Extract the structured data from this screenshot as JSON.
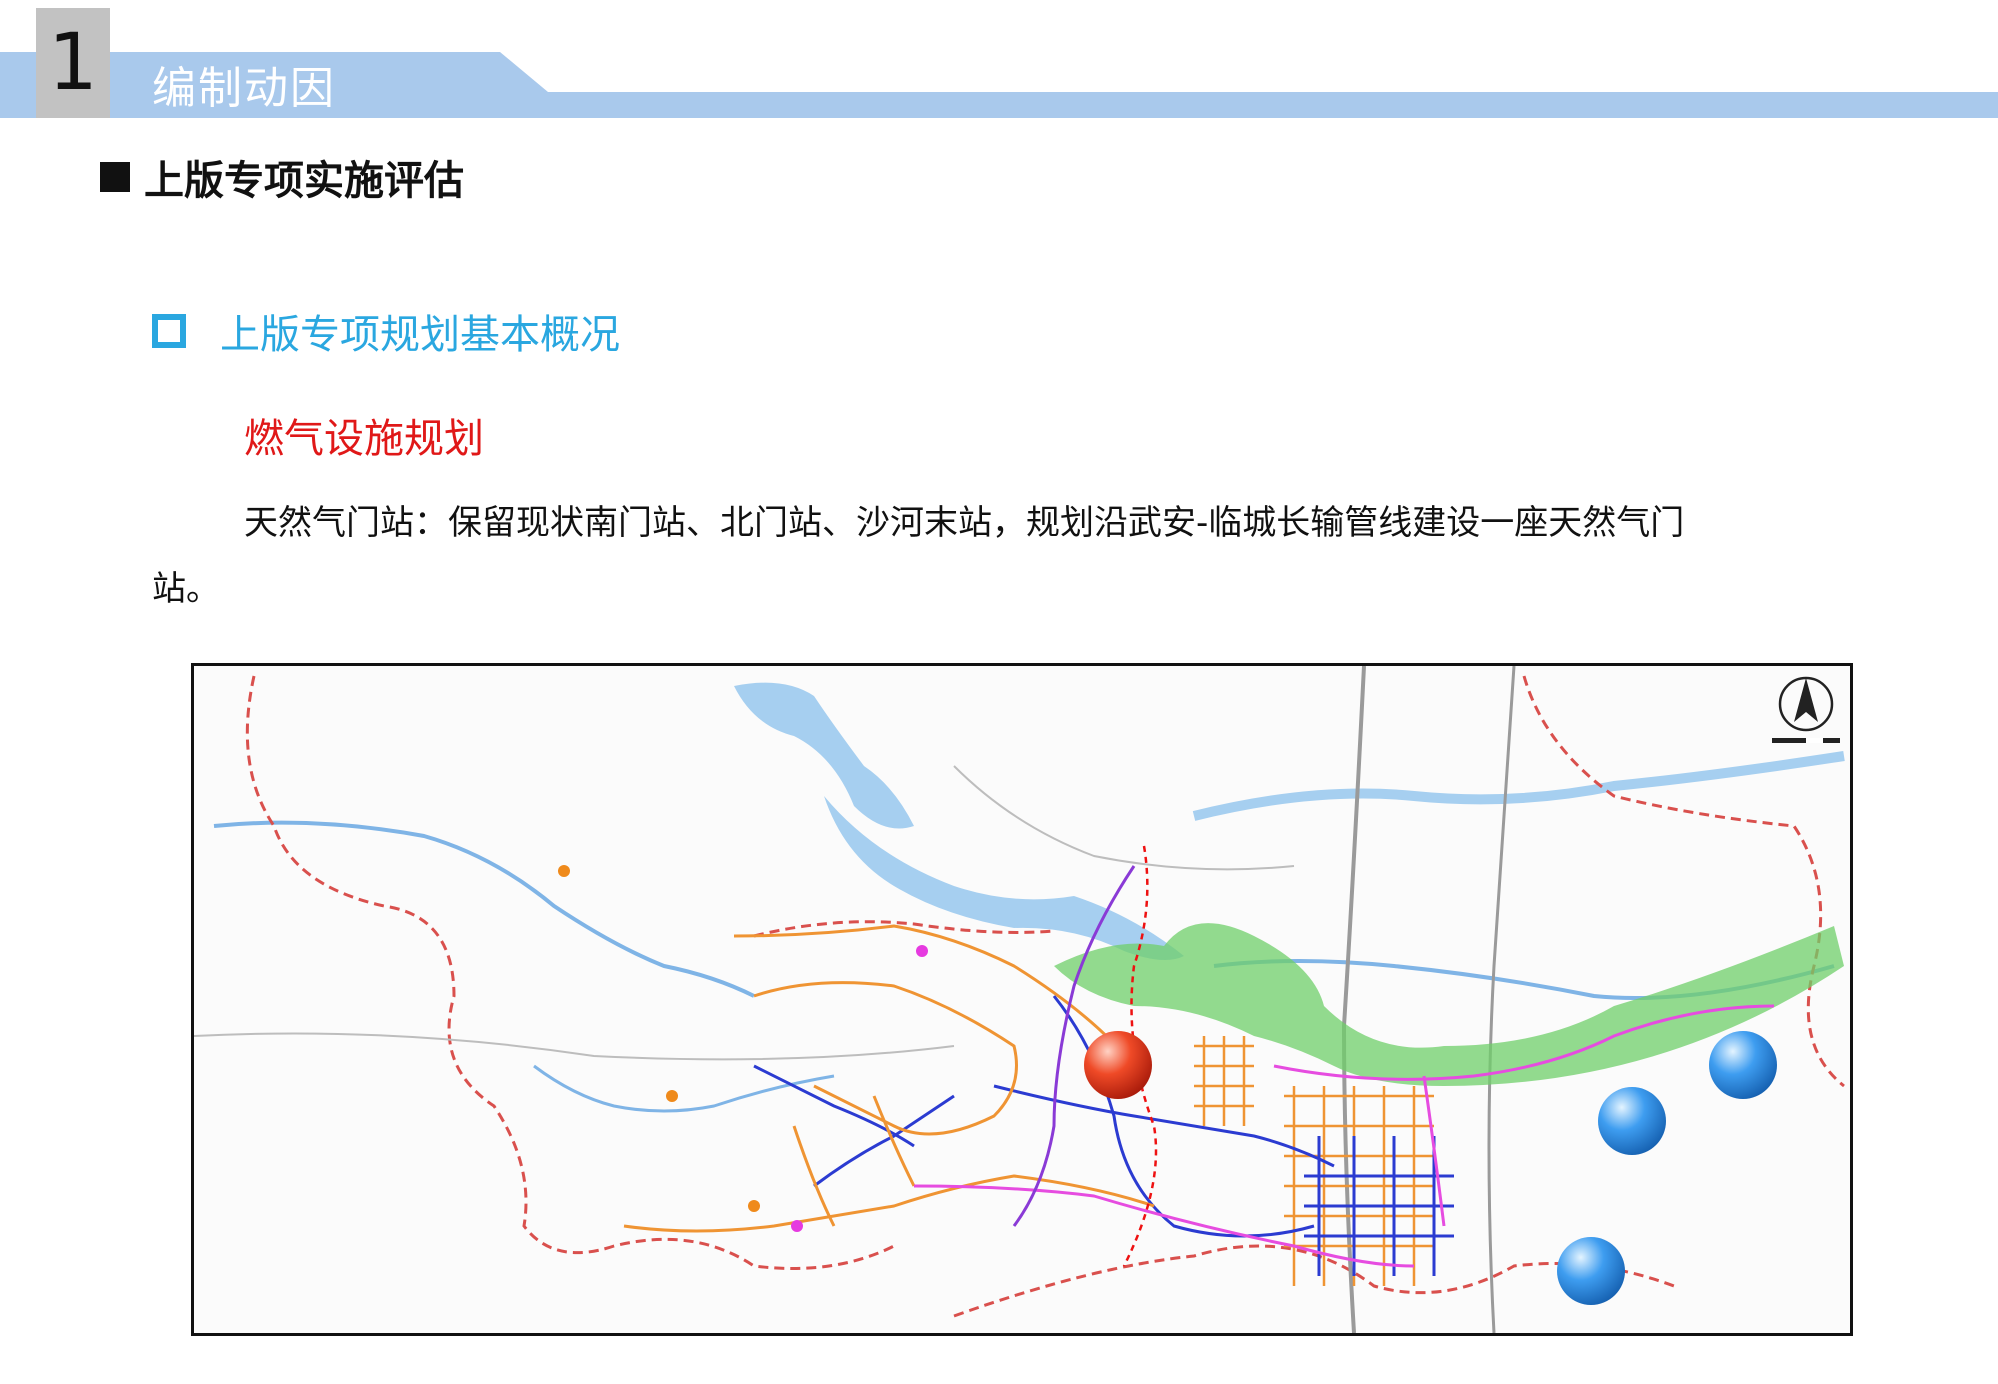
{
  "header": {
    "section_number": "1",
    "section_title": "编制动因",
    "band_color": "#a9c9ec"
  },
  "h2": {
    "text": "上版专项实施评估"
  },
  "h3": {
    "text": "上版专项规划基本概况",
    "color": "#2aa7e0"
  },
  "h4": {
    "text": "燃气设施规划",
    "color": "#e01818"
  },
  "paragraph": "天然气门站：保留现状南门站、北门站、沙河末站，规划沿武安-临城长输管线建设一座天然气门站。",
  "map": {
    "markers": [
      {
        "name": "planned-gate-station",
        "color": "red"
      },
      {
        "name": "existing-station",
        "color": "blue"
      },
      {
        "name": "existing-station",
        "color": "blue"
      },
      {
        "name": "existing-station",
        "color": "blue"
      }
    ],
    "colors": {
      "reservoir": "#a6cff0",
      "river": "#7fb4e6",
      "county_border": "#d9504d",
      "road": "#9a9a9a",
      "pipeline_orange": "#ef9433",
      "pipeline_blue": "#2b3bd1",
      "pipeline_magenta": "#e64ce0",
      "pipeline_purple": "#8a3ad6",
      "green_belt": "#6fcf6a"
    },
    "icons": [
      "north-arrow-icon",
      "scale-bar"
    ]
  }
}
